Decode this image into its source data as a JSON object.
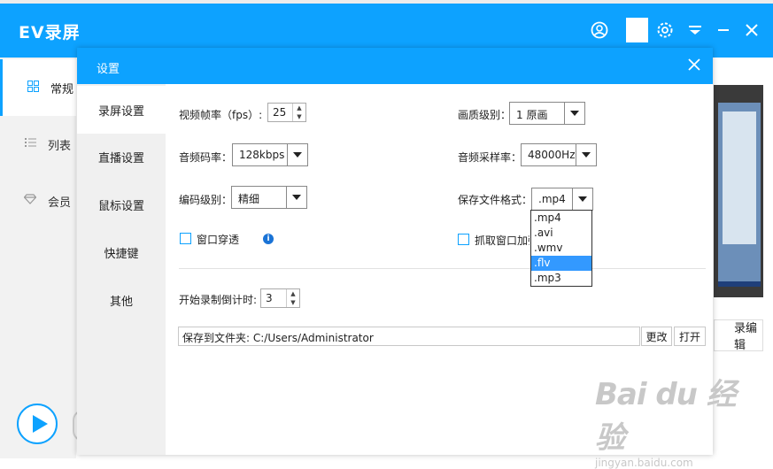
{
  "app": {
    "title": "EV录屏"
  },
  "titlebar_icons": [
    "user-icon",
    "settings-gear-icon",
    "dropdown-menu-icon",
    "minimize-icon",
    "close-icon"
  ],
  "sidebar": {
    "items": [
      {
        "label": "常规",
        "icon": "grid-icon",
        "active": true
      },
      {
        "label": "列表",
        "icon": "list-icon",
        "active": false
      },
      {
        "label": "会员",
        "icon": "diamond-icon",
        "active": false
      }
    ]
  },
  "right_panel": {
    "edit_label": "录编辑"
  },
  "dialog": {
    "title": "设置",
    "nav": [
      {
        "label": "录屏设置",
        "active": true
      },
      {
        "label": "直播设置",
        "active": false
      },
      {
        "label": "鼠标设置",
        "active": false
      },
      {
        "label": "快捷键",
        "active": false
      },
      {
        "label": "其他",
        "active": false
      }
    ],
    "fields": {
      "fps_label": "视频帧率（fps）:",
      "fps_value": "25",
      "quality_label": "画质级别：",
      "quality_value": "1 原画",
      "audio_bitrate_label": "音频码率：",
      "audio_bitrate_value": "128kbps",
      "sample_rate_label": "音频采样率：",
      "sample_rate_value": "48000Hz",
      "encode_label": "编码级别：",
      "encode_value": "精细",
      "format_label": "保存文件格式：",
      "format_value": ".mp4",
      "window_through_label": "窗口穿透",
      "capture_window_label": "抓取窗口加强",
      "countdown_label": "开始录制倒计时:",
      "countdown_value": "3",
      "save_folder_label": "保存到文件夹:",
      "save_folder_value": "C:/Users/Administrator",
      "change_btn": "更改",
      "open_btn": "打开"
    },
    "format_options": [
      ".mp4",
      ".avi",
      ".wmv",
      ".flv",
      ".mp3"
    ],
    "format_selected_index": 3
  },
  "watermark": {
    "logo": "Bai  du 经验",
    "url": "jingyan.baidu.com"
  },
  "colors": {
    "accent": "#0da2ff",
    "selected_option": "#3399ff"
  }
}
